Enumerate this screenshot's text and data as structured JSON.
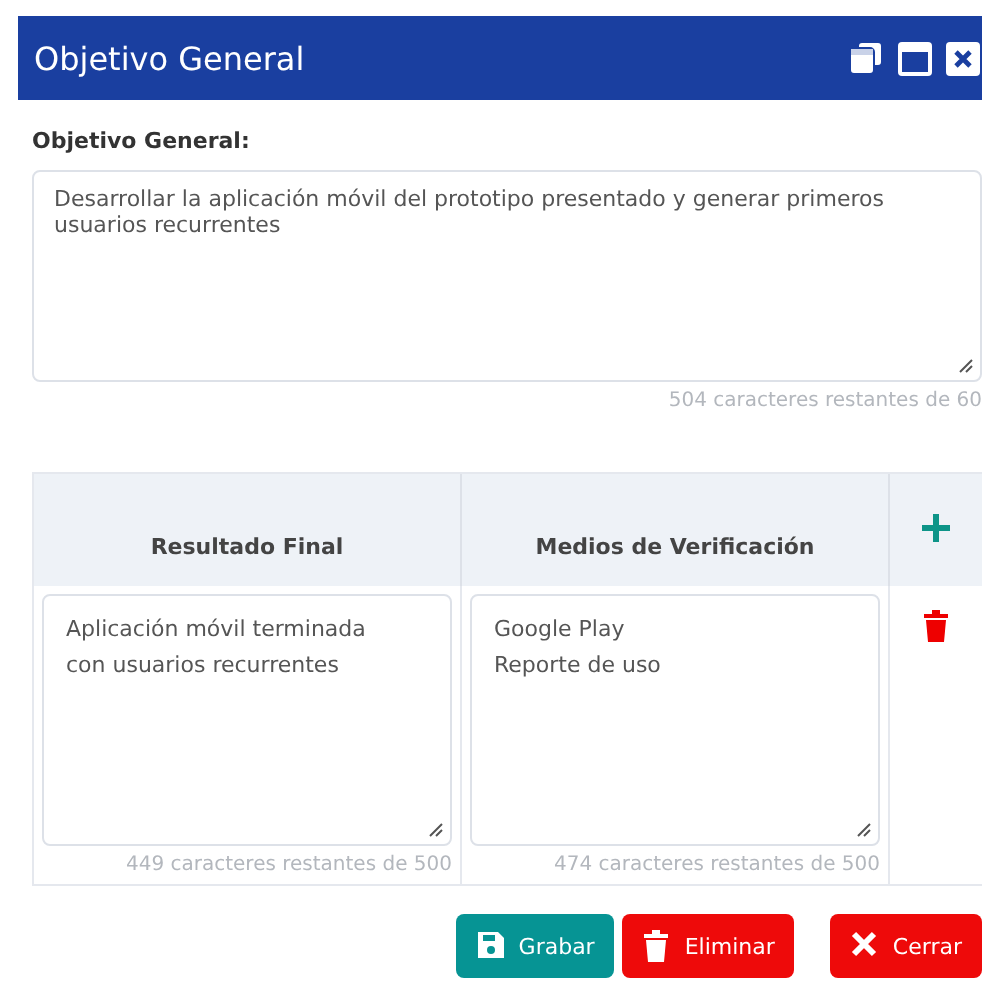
{
  "window": {
    "title": "Objetivo General"
  },
  "objective": {
    "label": "Objetivo General:",
    "value": "Desarrollar la aplicación móvil del prototipo presentado y generar primeros usuarios recurrentes",
    "counter": "504 caracteres restantes de 60"
  },
  "table": {
    "columns": [
      "Resultado Final",
      "Medios de Verificación"
    ],
    "rows": [
      {
        "cells": [
          {
            "value": "Aplicación móvil terminada\ncon usuarios recurrentes",
            "counter": "449 caracteres restantes de 500"
          },
          {
            "value": "Google Play\nReporte de uso",
            "counter": "474 caracteres restantes de 500"
          }
        ]
      }
    ]
  },
  "buttons": [
    {
      "kind": "save",
      "label": "Grabar"
    },
    {
      "kind": "delete",
      "label": "Eliminar"
    },
    {
      "kind": "close",
      "label": "Cerrar"
    }
  ]
}
